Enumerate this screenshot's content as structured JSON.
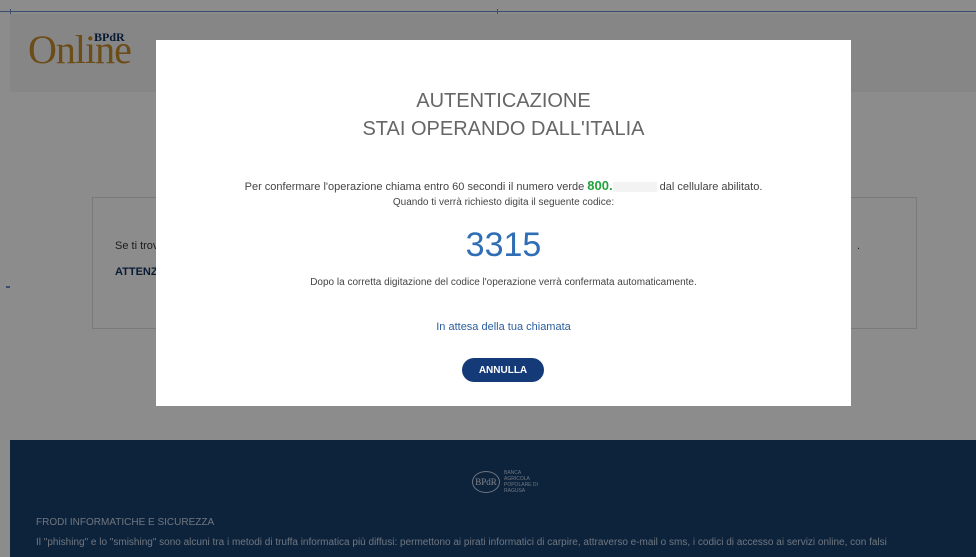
{
  "header": {
    "logo_text": "Online",
    "logo_badge": "BPdR"
  },
  "background_card": {
    "line1": "Se ti trov",
    "line2": "ATTENZ",
    "right_fragment": "."
  },
  "modal": {
    "title_line1": "AUTENTICAZIONE",
    "title_line2": "STAI OPERANDO DALL'ITALIA",
    "instruction_prefix": "Per confermare l'operazione chiama entro 60 secondi il numero verde ",
    "phone_number_visible": "800.",
    "instruction_suffix": " dal cellulare abilitato.",
    "instruction_line2": "Quando ti verrà richiesto digita il seguente codice:",
    "code": "3315",
    "instruction_line3": "Dopo la corretta digitazione del codice l'operazione verrà confermata automaticamente.",
    "waiting_text": "In attesa della tua chiamata",
    "cancel_label": "ANNULLA"
  },
  "footer": {
    "seal_text": "BPdR",
    "bank_name": "BANCA AGRICOLA POPOLARE DI RAGUSA",
    "title": "FRODI INFORMATICHE E SICUREZZA",
    "text": "Il \"phishing\" e lo \"smishing\" sono alcuni tra i metodi di truffa informatica più diffusi: permettono ai pirati informatici di carpire, attraverso e-mail o sms, i codici di accesso ai servizi online, con falsi"
  },
  "colors": {
    "code_blue": "#2f6db4",
    "phone_green": "#22a33a",
    "button_navy": "#143a78",
    "footer_navy": "#18406e"
  }
}
